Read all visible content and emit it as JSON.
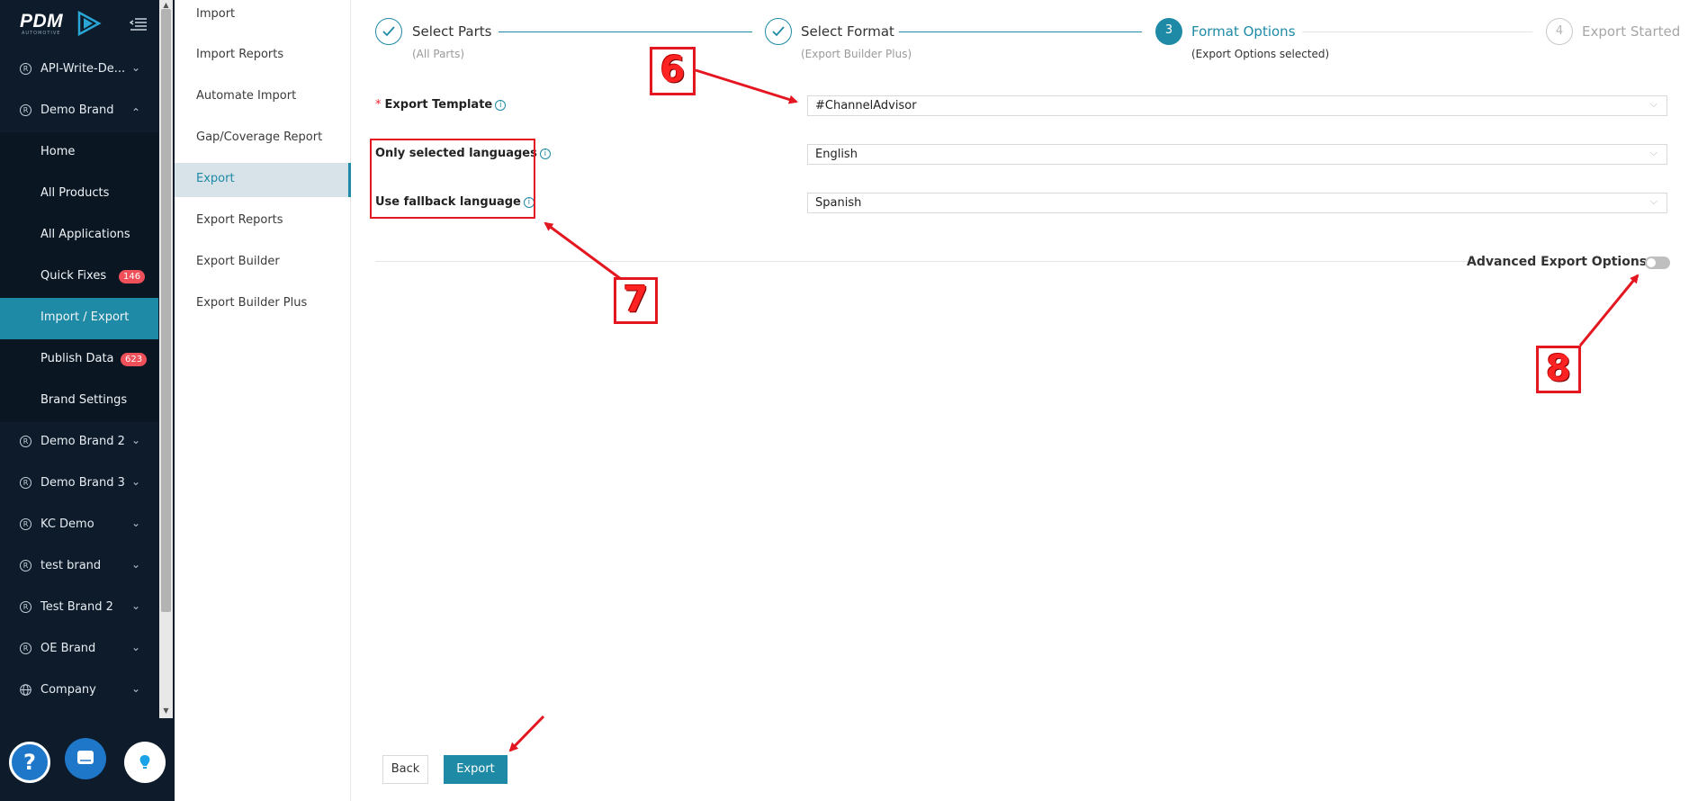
{
  "sidebar": {
    "logo": "PDM",
    "logo_sub": "AUTOMOTIVE",
    "items": [
      {
        "label": "API-Write-De...",
        "icon": "R"
      },
      {
        "label": "Demo Brand",
        "icon": "R"
      },
      {
        "label": "Home"
      },
      {
        "label": "All Products"
      },
      {
        "label": "All Applications"
      },
      {
        "label": "Quick Fixes",
        "badge": "146"
      },
      {
        "label": "Import / Export"
      },
      {
        "label": "Publish Data",
        "badge": "623"
      },
      {
        "label": "Brand Settings"
      },
      {
        "label": "Demo Brand 2",
        "icon": "R"
      },
      {
        "label": "Demo Brand 3",
        "icon": "R"
      },
      {
        "label": "KC Demo",
        "icon": "R"
      },
      {
        "label": "test brand",
        "icon": "R"
      },
      {
        "label": "Test Brand 2",
        "icon": "R"
      },
      {
        "label": "OE Brand",
        "icon": "R"
      },
      {
        "label": "Company"
      }
    ],
    "help_glyph": "?"
  },
  "submenu": {
    "items": [
      {
        "label": "Import"
      },
      {
        "label": "Import Reports"
      },
      {
        "label": "Automate Import"
      },
      {
        "label": "Gap/Coverage Report"
      },
      {
        "label": "Export"
      },
      {
        "label": "Export Reports"
      },
      {
        "label": "Export Builder"
      },
      {
        "label": "Export Builder Plus"
      }
    ]
  },
  "steps": [
    {
      "title": "Select Parts",
      "sub": "(All Parts)",
      "state": "done"
    },
    {
      "title": "Select Format",
      "sub": "(Export Builder Plus)",
      "state": "done"
    },
    {
      "title": "Format Options",
      "sub": "(Export Options selected)",
      "state": "current",
      "number": "3"
    },
    {
      "title": "Export Started",
      "sub": "",
      "state": "pending",
      "number": "4"
    }
  ],
  "form": {
    "required_mark": "*",
    "export_template": {
      "label": "Export Template",
      "value": "#ChannelAdvisor"
    },
    "only_languages": {
      "label": "Only selected languages",
      "value": "English"
    },
    "fallback_language": {
      "label": "Use fallback language",
      "value": "Spanish"
    },
    "info_glyph": "i"
  },
  "advanced": {
    "label": "Advanced Export Options",
    "enabled": false
  },
  "buttons": {
    "back": "Back",
    "export": "Export"
  },
  "annotations": {
    "six": "6",
    "seven": "7",
    "eight": "8"
  },
  "colors": {
    "accent": "#1e8aa5",
    "sidebar_bg": "#0d1b2a",
    "annotation": "#e4161f",
    "badge": "#f0505a"
  }
}
